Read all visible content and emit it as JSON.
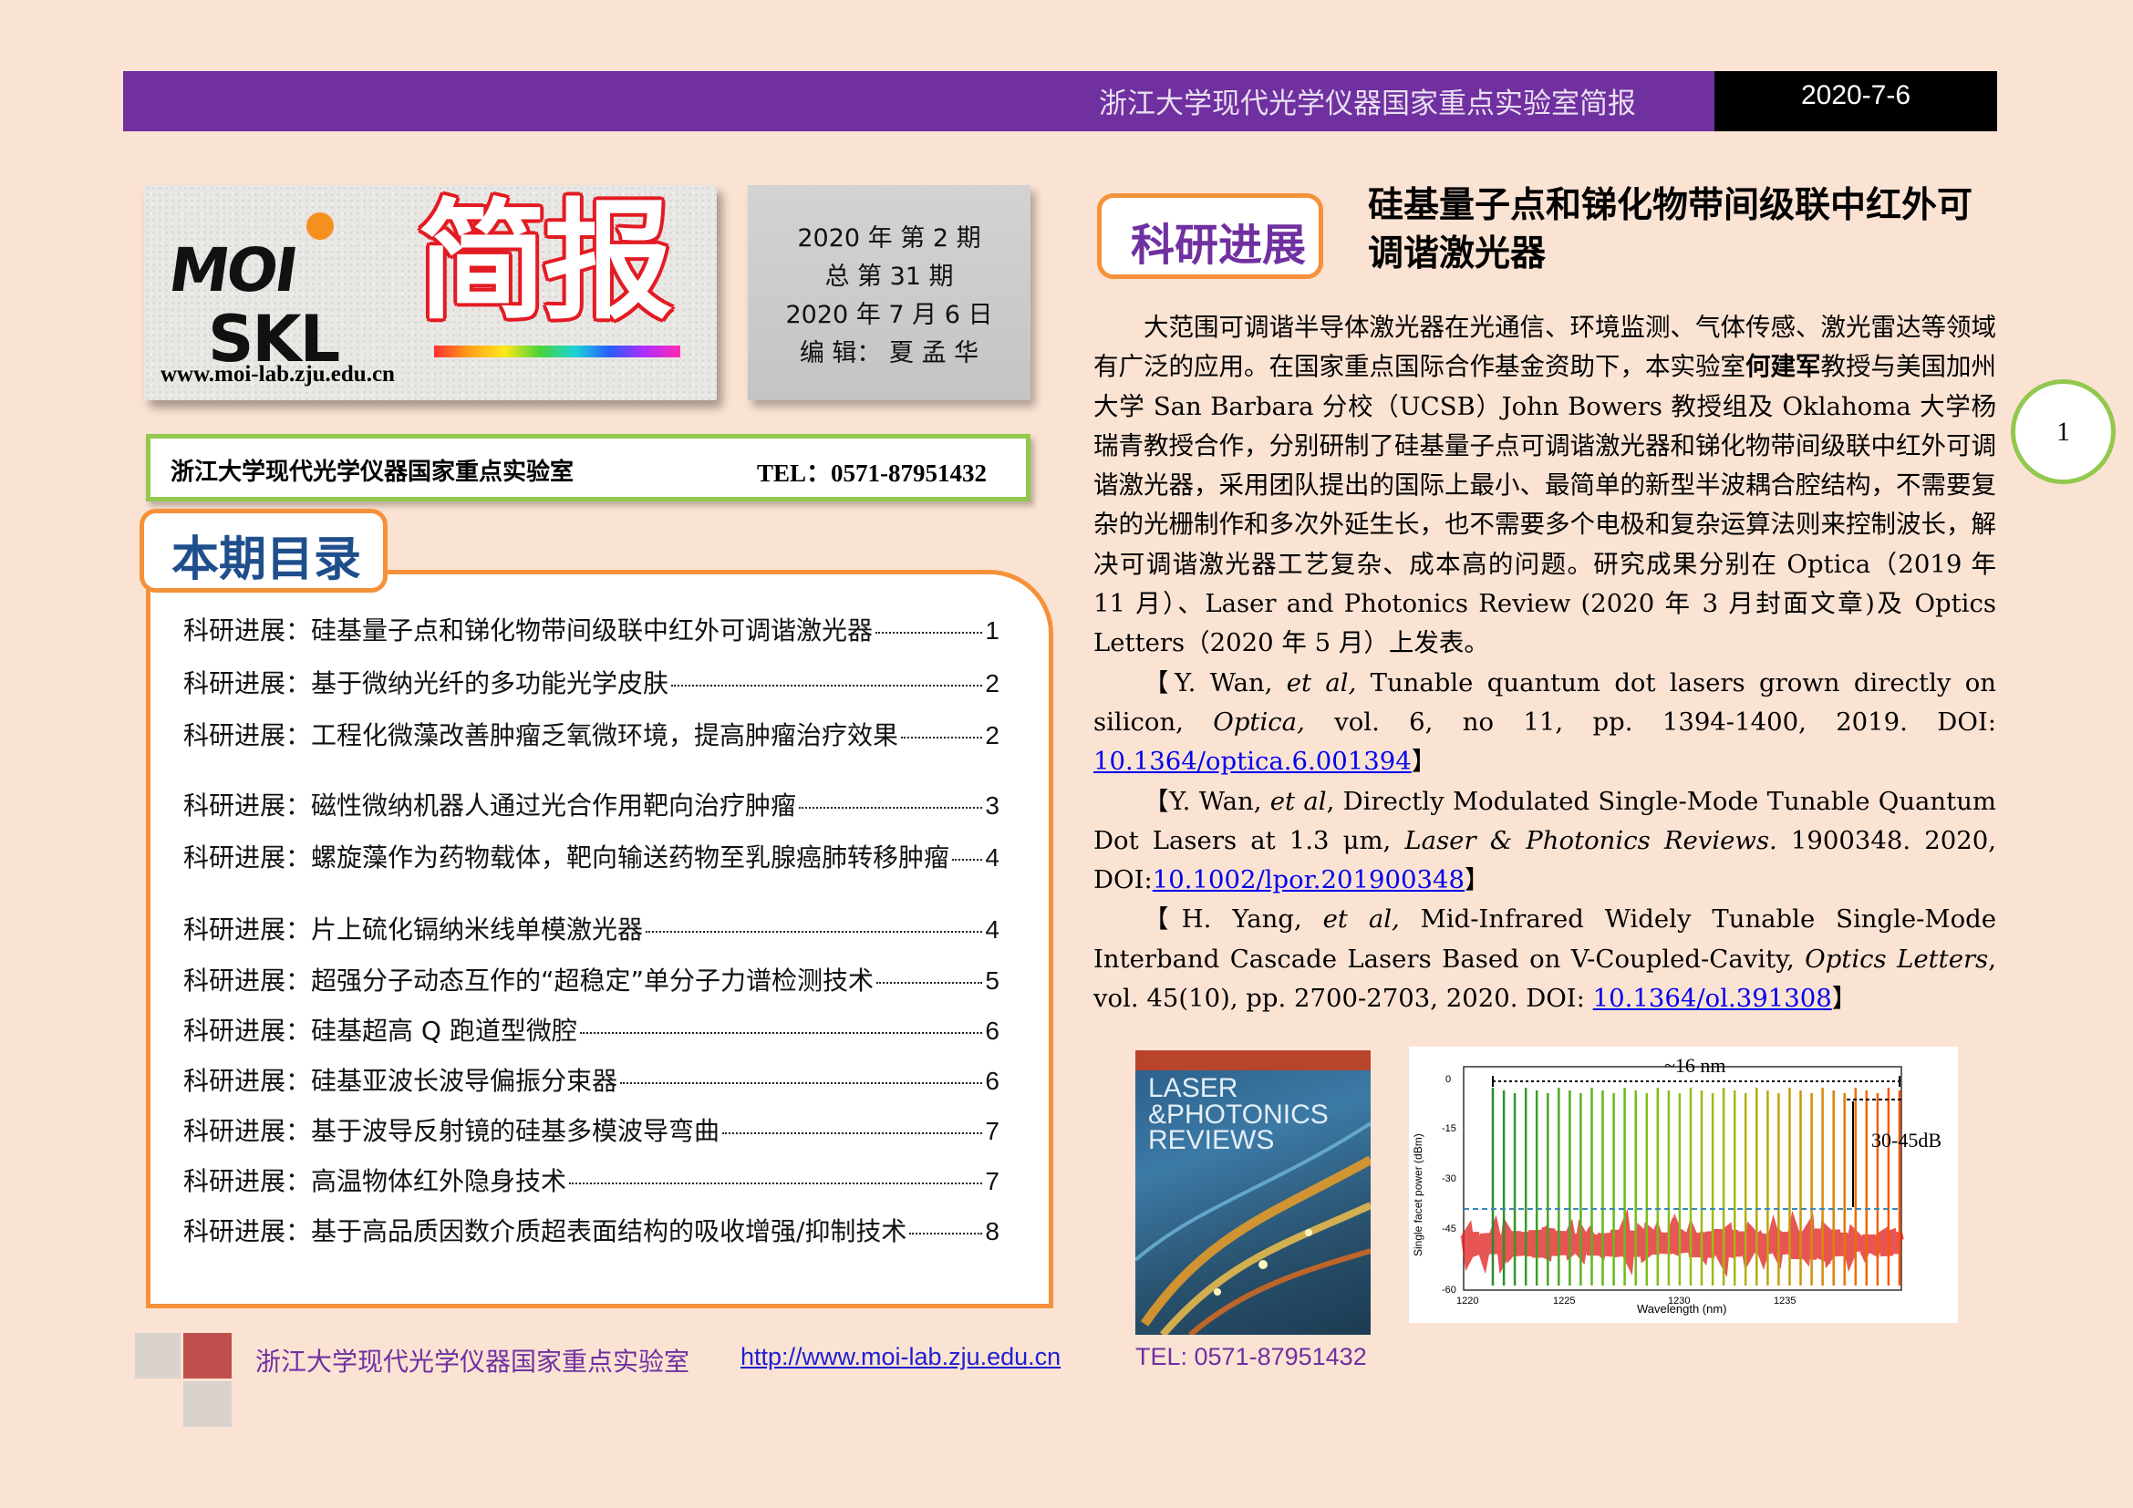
{
  "header": {
    "title": "浙江大学现代光学仪器国家重点实验室简报",
    "date": "2020-7-6"
  },
  "logo": {
    "moi": "MOI",
    "skl": "SKL",
    "brand": "简报",
    "url": "www.moi-lab.zju.edu.cn"
  },
  "issue": {
    "line1": "2020 年 第 2  期",
    "line2": "总 第 31 期",
    "line3": "2020 年 7 月 6 日",
    "line4": "编 辑： 夏 孟 华"
  },
  "lab_bar": {
    "name": "浙江大学现代光学仪器国家重点实验室",
    "tel": "TEL：0571-87951432"
  },
  "toc": {
    "title": "本期目录",
    "items": [
      {
        "text": "科研进展：硅基量子点和锑化物带间级联中红外可调谐激光器",
        "page": "1"
      },
      {
        "text": "科研进展：基于微纳光纤的多功能光学皮肤",
        "page": "2"
      },
      {
        "text": "科研进展：工程化微藻改善肿瘤乏氧微环境，提高肿瘤治疗效果",
        "page": "2"
      },
      {
        "text": "科研进展：磁性微纳机器人通过光合作用靶向治疗肿瘤",
        "page": "3"
      },
      {
        "text": "科研进展：螺旋藻作为药物载体，靶向输送药物至乳腺癌肺转移肿瘤",
        "page": "4"
      },
      {
        "text": "科研进展：片上硫化镉纳米线单模激光器",
        "page": "4"
      },
      {
        "text": "科研进展：超强分子动态互作的“超稳定”单分子力谱检测技术",
        "page": "5"
      },
      {
        "text": "科研进展：硅基超高 Q 跑道型微腔",
        "page": "6"
      },
      {
        "text": "科研进展：硅基亚波长波导偏振分束器",
        "page": "6"
      },
      {
        "text": "科研进展：基于波导反射镜的硅基多模波导弯曲",
        "page": "7"
      },
      {
        "text": "科研进展：高温物体红外隐身技术",
        "page": "7"
      },
      {
        "text": "科研进展：基于高品质因数介质超表面结构的吸收增强/抑制技术",
        "page": "8"
      }
    ]
  },
  "article": {
    "section_label": "科研进展",
    "title": "硅基量子点和锑化物带间级联中红外可调谐激光器",
    "para1_a": "大范围可调谐半导体激光器在光通信、环境监测、气体传感、激光雷达等领域有广泛的应用。在国家重点国际合作基金资助下，本实验室",
    "para1_name": "何建军",
    "para1_b": "教授与美国加州大学 San Barbara 分校（UCSB）John Bowers 教授组及 Oklahoma 大学杨瑞青教授合作，分别研制了硅基量子点可调谐激光器和锑化物带间级联中红外可调谐激光器，采用团队提出的国际上最小、最简单的新型半波耦合腔结构，不需要复杂的光栅制作和多次外延生长，也不需要多个电极和复杂运算法则来控制波长，解决可调谐激光器工艺复杂、成本高的问题。研究成果分别在 Optica（2019 年 11 月）、Laser and Photonics Review (2020 年 3 月封面文章)及 Optics Letters（2020 年 5 月）上发表。",
    "ref1_a": "【Y. Wan, ",
    "ref1_etal": "et al,",
    "ref1_b": " Tunable quantum dot lasers grown directly on silicon, ",
    "ref1_journal": "Optica,",
    "ref1_c": " vol. 6, no 11, pp. 1394-1400, 2019. DOI: ",
    "ref1_doi": "10.1364/optica.6.001394",
    "ref1_end": "】",
    "ref2_a": "【Y. Wan, ",
    "ref2_etal": "et al",
    "ref2_b": ", Directly Modulated Single-Mode Tunable Quantum Dot Lasers at 1.3 μm, ",
    "ref2_journal": "Laser & Photonics Reviews.",
    "ref2_c": " 1900348. 2020, DOI:",
    "ref2_doi": "10.1002/lpor.201900348",
    "ref2_end": "】",
    "ref3_a": "【H. Yang, ",
    "ref3_etal": "et al,",
    "ref3_b": " Mid-Infrared Widely Tunable Single-Mode Interband Cascade Lasers Based on V-Coupled-Cavity, ",
    "ref3_journal": "Optics Letters",
    "ref3_c": ", vol. 45(10), pp. 2700-2703, 2020. DOI: ",
    "ref3_doi": "10.1364/ol.391308",
    "ref3_end": "】"
  },
  "page_number": "1",
  "cover_image": {
    "title_line1": "LASER",
    "title_line2": "&PHOTONICS",
    "title_line3": "REVIEWS"
  },
  "spectrum_image": {
    "span_label": "~16 nm",
    "smsr_label": "30-45dB",
    "ylabel": "Single facet power (dBm)",
    "xlabel": "Wavelength (nm)",
    "yticks": [
      "0",
      "-15",
      "-30",
      "-45",
      "-60"
    ],
    "xticks": [
      "1220",
      "1225",
      "1230",
      "1235"
    ]
  },
  "footer": {
    "lab": "浙江大学现代光学仪器国家重点实验室",
    "url": "http://www.moi-lab.zju.edu.cn",
    "tel": "TEL: 0571-87951432"
  },
  "colors": {
    "page_bg": "#fbe3d3",
    "banner_purple": "#7030a0",
    "accent_orange": "#f5913a",
    "accent_green": "#92c84e",
    "brand_red": "#e31b23"
  }
}
